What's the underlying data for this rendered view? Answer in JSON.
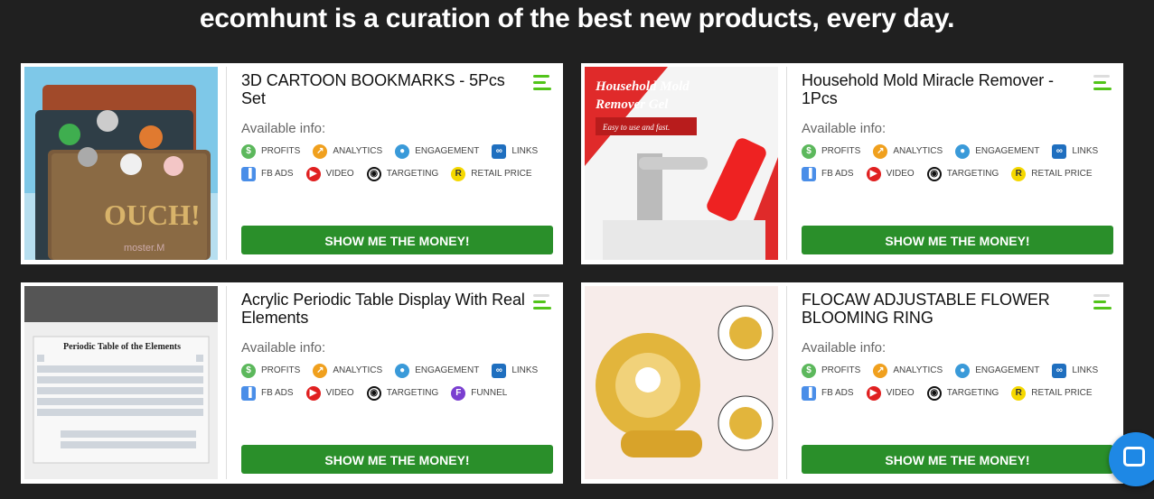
{
  "headline": "ecomhunt is a curation of the best new products, every day.",
  "available_label": "Available info:",
  "cta_label": "SHOW ME THE MONEY!",
  "colors": {
    "background": "#202020",
    "cta": "#2a8f2a",
    "score_green": "#52c41a"
  },
  "products": [
    {
      "title": "3D CARTOON BOOKMARKS - 5Pcs Set",
      "image_text": [
        "OUCH!",
        "moster.M"
      ],
      "chips_row1": [
        "PROFITS",
        "ANALYTICS",
        "ENGAGEMENT",
        "LINKS"
      ],
      "chips_row2": [
        "FB ADS",
        "VIDEO",
        "TARGETING",
        "RETAIL PRICE"
      ]
    },
    {
      "title": "Household Mold Miracle Remover - 1Pcs",
      "image_text": [
        "Household Mold",
        "Remover Gel",
        "Easy to use and fast."
      ],
      "chips_row1": [
        "PROFITS",
        "ANALYTICS",
        "ENGAGEMENT",
        "LINKS"
      ],
      "chips_row2": [
        "FB ADS",
        "VIDEO",
        "TARGETING",
        "RETAIL PRICE"
      ]
    },
    {
      "title": "Acrylic Periodic Table Display With Real Elements",
      "image_text": [
        "Periodic Table of the Elements"
      ],
      "chips_row1": [
        "PROFITS",
        "ANALYTICS",
        "ENGAGEMENT",
        "LINKS"
      ],
      "chips_row2": [
        "FB ADS",
        "VIDEO",
        "TARGETING",
        "FUNNEL"
      ]
    },
    {
      "title": "FLOCAW ADJUSTABLE FLOWER BLOOMING RING",
      "image_text": [],
      "chips_row1": [
        "PROFITS",
        "ANALYTICS",
        "ENGAGEMENT",
        "LINKS"
      ],
      "chips_row2": [
        "FB ADS",
        "VIDEO",
        "TARGETING",
        "RETAIL PRICE"
      ]
    }
  ],
  "icons": {
    "PROFITS": {
      "name": "dollar-icon",
      "glyph": "$",
      "color": "#5cb85c"
    },
    "ANALYTICS": {
      "name": "analytics-icon",
      "glyph": "↗",
      "color": "#f0a01e"
    },
    "ENGAGEMENT": {
      "name": "engagement-icon",
      "glyph": "●",
      "color": "#3a9ad9"
    },
    "LINKS": {
      "name": "link-icon",
      "glyph": "∞",
      "color": "#1f6fbf"
    },
    "FB ADS": {
      "name": "fb-ads-icon",
      "glyph": "▐",
      "color": "#4a8ee8"
    },
    "VIDEO": {
      "name": "video-play-icon",
      "glyph": "▶",
      "color": "#e02020"
    },
    "TARGETING": {
      "name": "target-icon",
      "glyph": "◉",
      "color": "#111111"
    },
    "RETAIL PRICE": {
      "name": "retail-price-icon",
      "glyph": "R",
      "color": "#f5d800"
    },
    "FUNNEL": {
      "name": "funnel-icon",
      "glyph": "F",
      "color": "#7a3fd0"
    }
  }
}
